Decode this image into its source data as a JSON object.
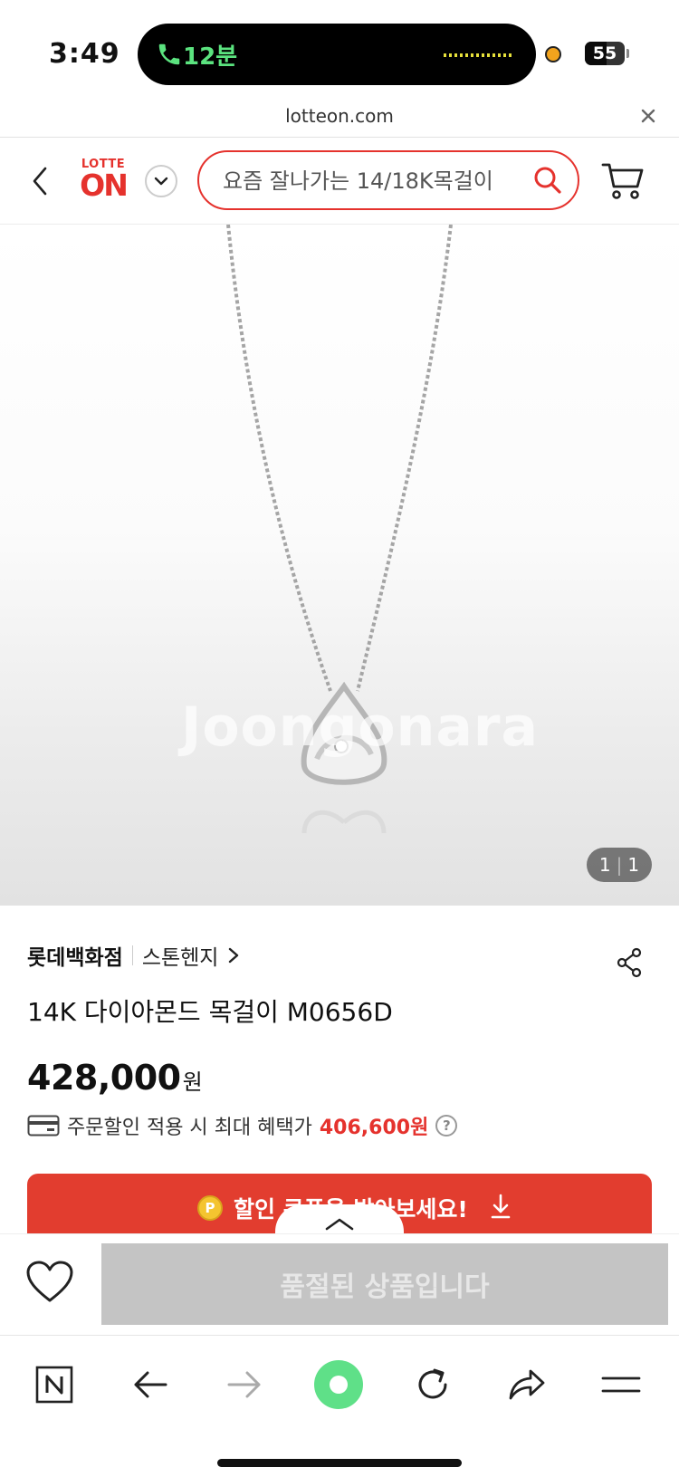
{
  "status": {
    "time": "3:49",
    "call_duration": "12분",
    "battery_level": "55",
    "battery_fraction": 0.55
  },
  "browser": {
    "url": "lotteon.com"
  },
  "header": {
    "logo_top": "LOTTE",
    "logo_main": "ON",
    "search_placeholder": "요즘 잘나가는 14/18K목걸이"
  },
  "gallery": {
    "watermark": "Joongonara",
    "current": "1",
    "total": "1"
  },
  "product": {
    "brand": "롯데백화점",
    "store": "스톤헨지",
    "name": "14K 다이아몬드 목걸이 M0656D",
    "price": "428,000",
    "price_unit": "원",
    "benefit_text": "주문할인 적용 시 최대 혜택가",
    "benefit_price": "406,600원",
    "help_mark": "?"
  },
  "coupon": {
    "coin_mark": "P",
    "text": "할인 쿠폰을 받아보세요!"
  },
  "action": {
    "soldout_label": "품절된 상품입니다"
  },
  "colors": {
    "brand_red": "#e5322d",
    "soldout_gray": "#c4c4c4",
    "call_green": "#5be37f"
  },
  "icons": [
    "phone-icon",
    "close-icon",
    "back-icon",
    "chevron-down-icon",
    "search-icon",
    "cart-icon",
    "share-icon",
    "card-icon",
    "download-icon",
    "chevron-up-icon",
    "heart-icon",
    "naver-icon",
    "arrow-left-icon",
    "arrow-right-icon",
    "green-dot-icon",
    "refresh-icon",
    "forward-share-icon",
    "menu-icon"
  ]
}
